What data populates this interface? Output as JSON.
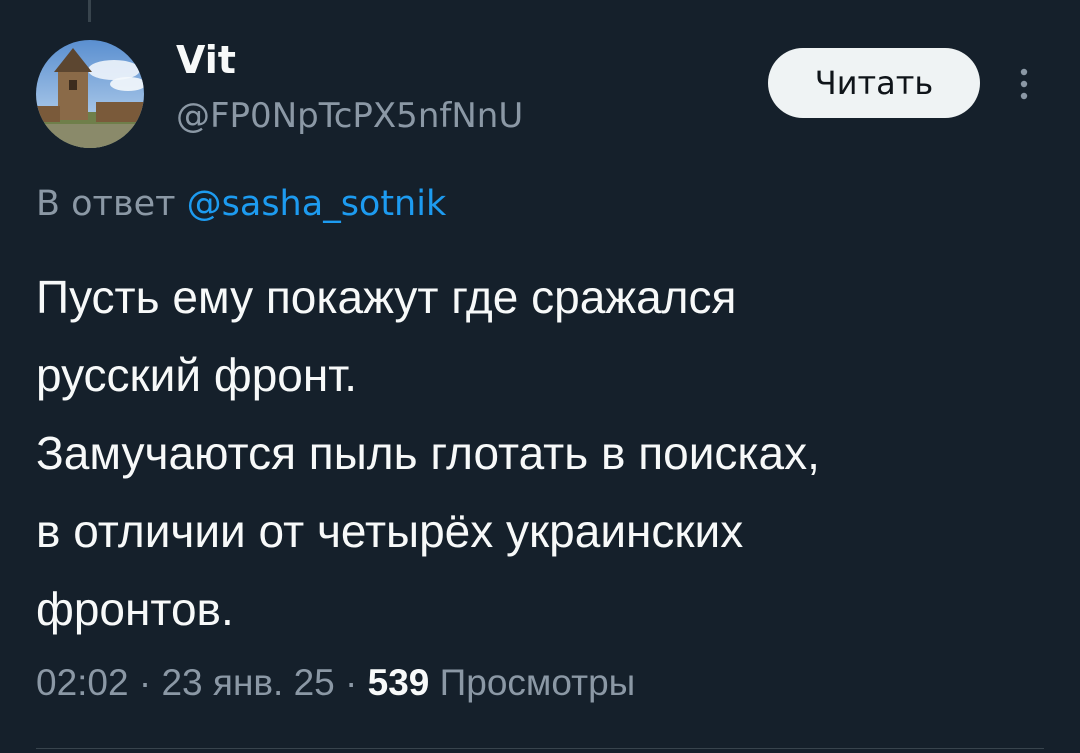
{
  "author": {
    "display_name": "Vit",
    "handle": "@FP0NpTcPX5nfNnU"
  },
  "follow_button": {
    "label": "Читать"
  },
  "more_icon": "more-vertical-icon",
  "reply": {
    "prefix": "В ответ",
    "mention": "@sasha_sotnik"
  },
  "tweet": {
    "lines": [
      "Пусть ему покажут где сражался",
      "русский фронт.",
      "Замучаются пыль глотать в поисках,",
      "в отличии от четырёх украинских",
      "фронтов."
    ]
  },
  "meta": {
    "time": "02:02",
    "separator": "·",
    "date": "23 янв. 25",
    "views_count": "539",
    "views_label": "Просмотры"
  },
  "colors": {
    "background": "#15202b",
    "text": "#f7f9f9",
    "secondary": "#8b98a5",
    "accent": "#1d9bf0"
  }
}
